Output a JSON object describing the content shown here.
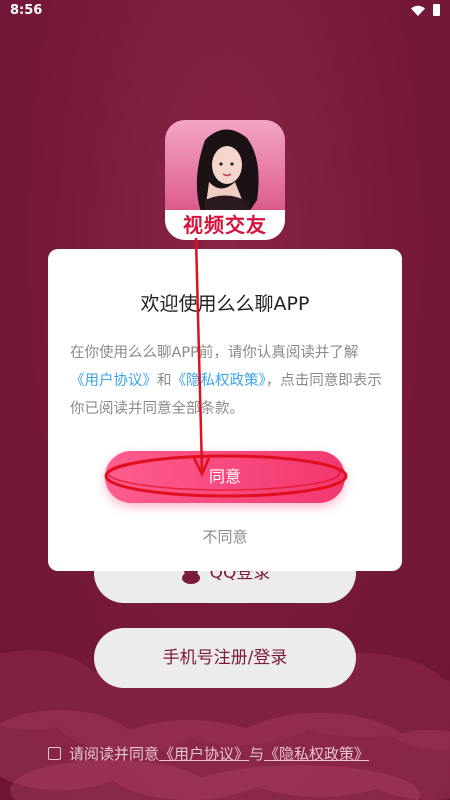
{
  "status_bar": {
    "time": "8:56"
  },
  "app": {
    "logo_text": "视频交友"
  },
  "dialog": {
    "title": "欢迎使用么么聊APP",
    "body_prefix": "在你使用么么聊APP前，请你认真阅读并了解",
    "user_agreement_link": "《用户协议》",
    "conjunction": "和",
    "privacy_policy_link": "《隐私权政策》",
    "body_suffix": "，点击同意即表示你已阅读并同意全部条款。",
    "agree_label": "同意",
    "disagree_label": "不同意"
  },
  "background": {
    "qq_login_label": "QQ登录",
    "phone_login_label": "手机号注册/登录"
  },
  "footer": {
    "agree_prefix": "请阅读并同意",
    "user_agreement_link": "《用户协议》",
    "conjunction": "与",
    "privacy_policy_link": "《隐私权政策》"
  },
  "colors": {
    "background": "#7c1c3a",
    "accent": "#f2386e",
    "link": "#3aa4e8",
    "annotation": "#e01020"
  },
  "icons": [
    "wifi-icon",
    "battery-icon",
    "qq-icon",
    "checkbox-icon"
  ]
}
